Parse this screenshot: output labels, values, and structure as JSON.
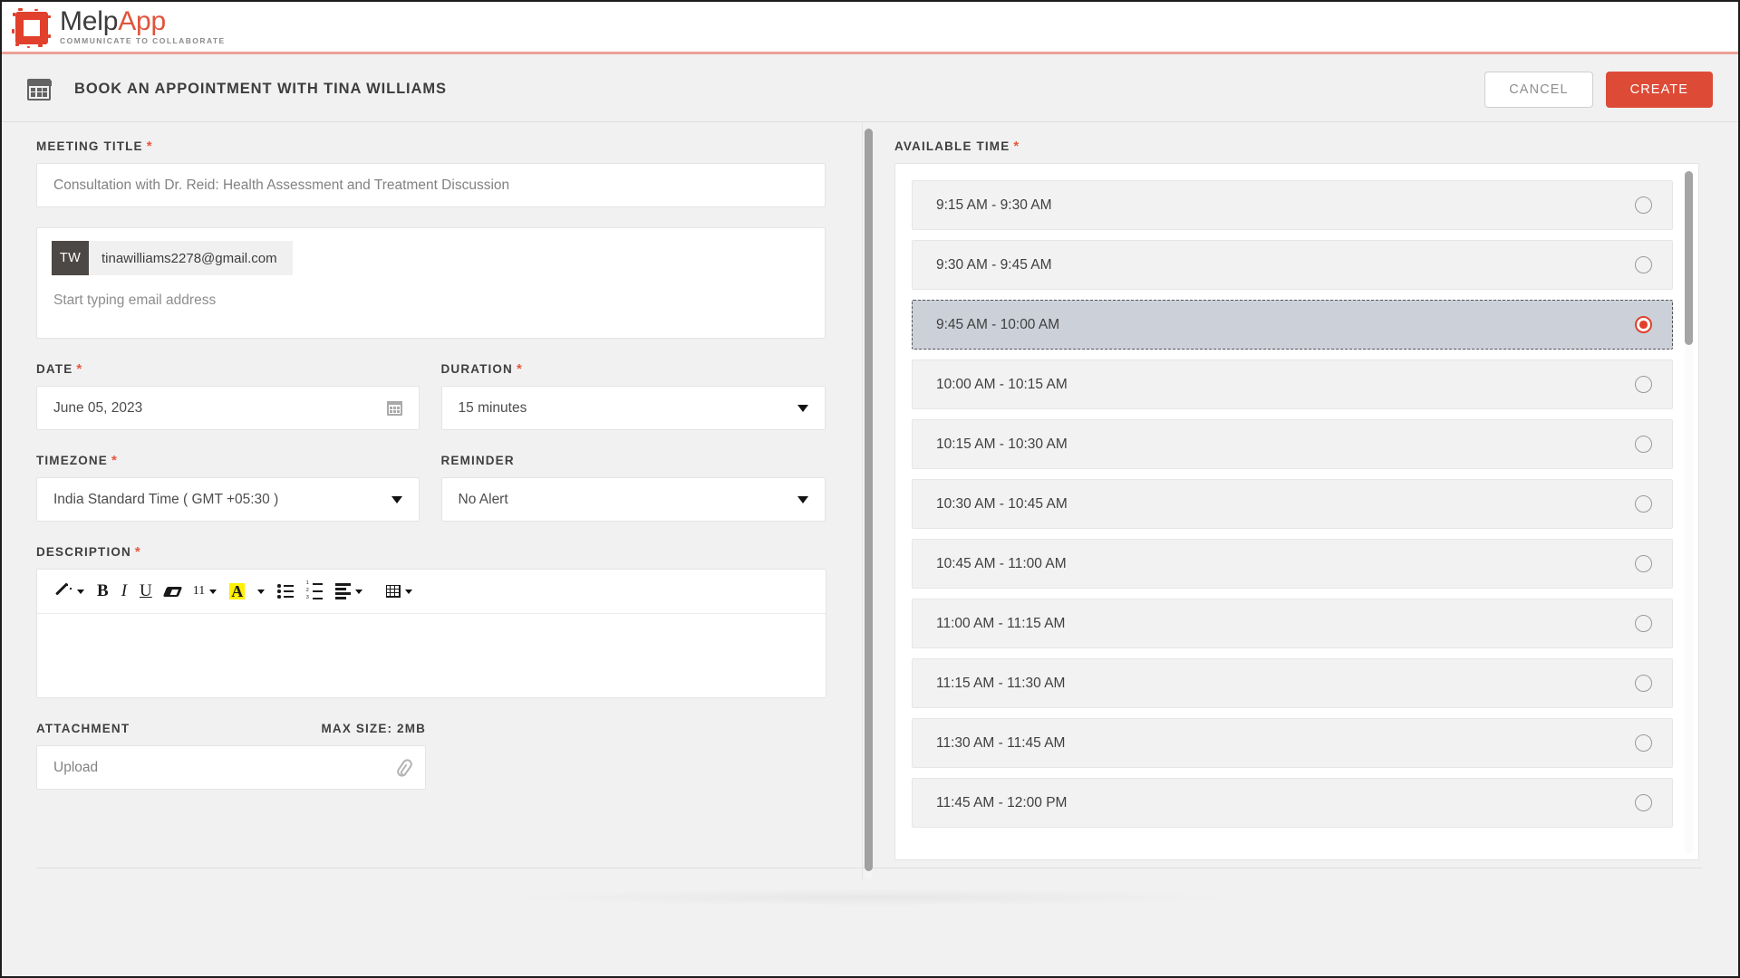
{
  "brand": {
    "name_part1": "Melp",
    "name_part2": "App",
    "tagline": "COMMUNICATE TO COLLABORATE",
    "accent_color": "#e0543c"
  },
  "titlebar": {
    "icon": "calendar-icon",
    "title": "BOOK AN APPOINTMENT WITH TINA WILLIAMS",
    "cancel_label": "CANCEL",
    "create_label": "CREATE",
    "create_color": "#dd4b37"
  },
  "form": {
    "meeting_title": {
      "label": "MEETING TITLE",
      "required": "*",
      "value": "Consultation with Dr. Reid: Health Assessment and Treatment Discussion"
    },
    "attendees": {
      "chip": {
        "initials": "TW",
        "email": "tinawilliams2278@gmail.com"
      },
      "placeholder": "Start typing email address"
    },
    "date": {
      "label": "DATE",
      "required": "*",
      "value": "June 05, 2023"
    },
    "duration": {
      "label": "DURATION",
      "required": "*",
      "value": "15 minutes"
    },
    "timezone": {
      "label": "TIMEZONE",
      "required": "*",
      "value": "India Standard Time ( GMT +05:30 )"
    },
    "reminder": {
      "label": "REMINDER",
      "value": "No Alert"
    },
    "description": {
      "label": "DESCRIPTION",
      "required": "*",
      "value": "",
      "toolbar": [
        {
          "name": "format-painter-icon",
          "label": "",
          "has_caret": true
        },
        {
          "name": "bold-icon",
          "label": "B",
          "has_caret": false
        },
        {
          "name": "italic-icon",
          "label": "I",
          "has_caret": false
        },
        {
          "name": "underline-icon",
          "label": "U",
          "has_caret": false
        },
        {
          "name": "clear-formatting-icon",
          "label": "",
          "has_caret": false
        },
        {
          "name": "font-size-icon",
          "label": "11",
          "has_caret": true
        },
        {
          "name": "text-highlight-icon",
          "label": "A",
          "has_caret": true
        },
        {
          "name": "bullet-list-icon",
          "label": "",
          "has_caret": false
        },
        {
          "name": "numbered-list-icon",
          "label": "",
          "has_caret": false
        },
        {
          "name": "align-icon",
          "label": "",
          "has_caret": true
        },
        {
          "name": "table-icon",
          "label": "",
          "has_caret": true
        }
      ]
    },
    "attachment": {
      "label": "ATTACHMENT",
      "max_size": "MAX SIZE: 2MB",
      "placeholder": "Upload"
    }
  },
  "available_time": {
    "label": "AVAILABLE TIME",
    "required": "*",
    "selected": "9:45 AM - 10:00 AM",
    "slots": [
      {
        "label": "9:15 AM - 9:30 AM",
        "selected": false
      },
      {
        "label": "9:30 AM - 9:45 AM",
        "selected": false
      },
      {
        "label": "9:45 AM - 10:00 AM",
        "selected": true
      },
      {
        "label": "10:00 AM - 10:15 AM",
        "selected": false
      },
      {
        "label": "10:15 AM - 10:30 AM",
        "selected": false
      },
      {
        "label": "10:30 AM - 10:45 AM",
        "selected": false
      },
      {
        "label": "10:45 AM - 11:00 AM",
        "selected": false
      },
      {
        "label": "11:00 AM - 11:15 AM",
        "selected": false
      },
      {
        "label": "11:15 AM - 11:30 AM",
        "selected": false
      },
      {
        "label": "11:30 AM - 11:45 AM",
        "selected": false
      },
      {
        "label": "11:45 AM - 12:00 PM",
        "selected": false
      }
    ]
  }
}
